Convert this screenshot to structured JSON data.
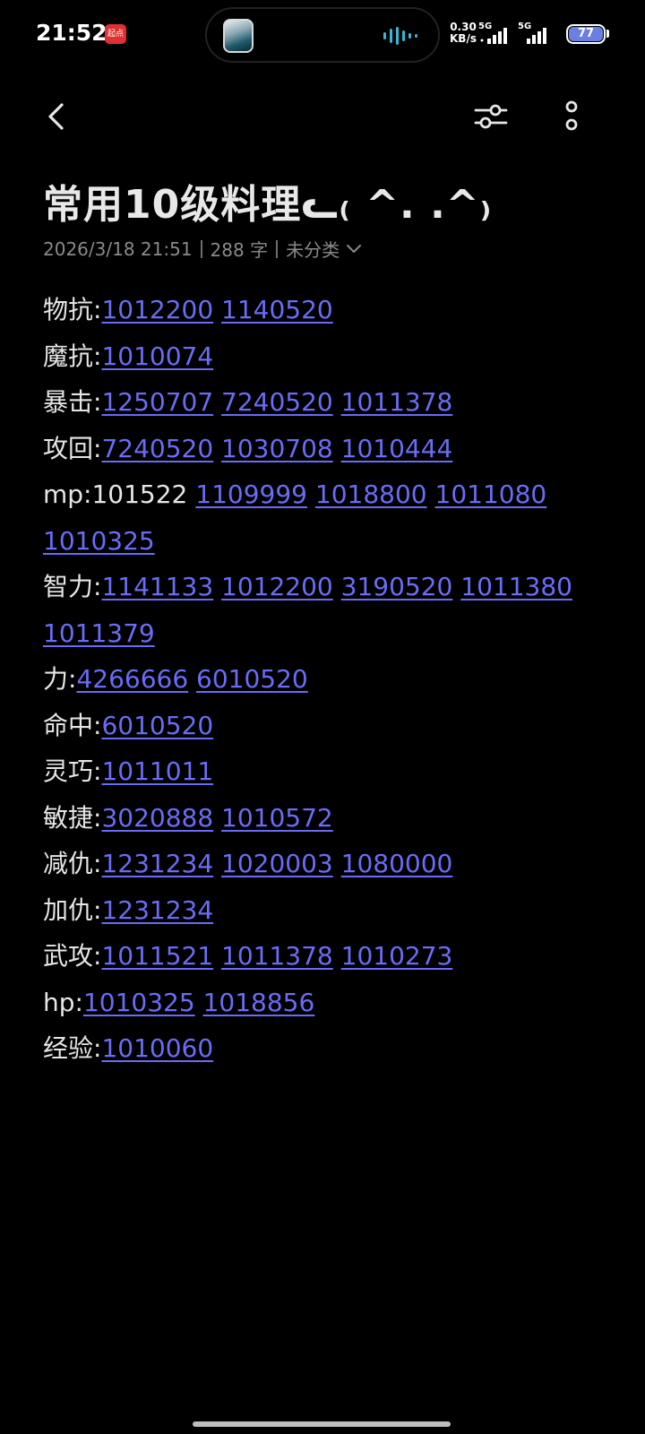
{
  "status_bar": {
    "time": "21:52",
    "app_badge": "起点",
    "net_speed_value": "0.30",
    "net_speed_unit": "KB/s",
    "sim1_label": "5G",
    "sim2_label": "5G",
    "battery": "77"
  },
  "note": {
    "title": "常用10级料理ᓚ₍ ^. .^₎",
    "date": "2026/3/18 21:51",
    "word_count": "288 字",
    "category": "未分类",
    "lines": [
      {
        "label": "物抗:",
        "codes": [
          "1012200",
          "1140520"
        ]
      },
      {
        "label": "魔抗:",
        "codes": [
          "1010074"
        ]
      },
      {
        "label": "暴击:",
        "codes": [
          "1250707",
          "7240520",
          "1011378"
        ]
      },
      {
        "label": "攻回:",
        "codes": [
          "7240520",
          "1030708",
          "1010444"
        ]
      },
      {
        "label": "mp:101522 ",
        "codes": [
          "1109999",
          "1018800",
          "1011080",
          "1010325"
        ]
      },
      {
        "label": "智力:",
        "codes": [
          "1141133",
          "1012200",
          "3190520",
          "1011380",
          "1011379"
        ]
      },
      {
        "label": "力:",
        "codes": [
          "4266666",
          "6010520"
        ]
      },
      {
        "label": "命中:",
        "codes": [
          "6010520"
        ]
      },
      {
        "label": "灵巧:",
        "codes": [
          "1011011"
        ]
      },
      {
        "label": "敏捷:",
        "codes": [
          "3020888",
          "1010572"
        ]
      },
      {
        "label": "减仇:",
        "codes": [
          "1231234",
          "1020003",
          "1080000"
        ]
      },
      {
        "label": "加仇:",
        "codes": [
          "1231234"
        ]
      },
      {
        "label": "武攻:",
        "codes": [
          "1011521",
          "1011378",
          "1010273"
        ]
      },
      {
        "label": "hp:",
        "codes": [
          "1010325",
          "1018856"
        ]
      },
      {
        "label": "经验:",
        "codes": [
          "1010060"
        ]
      }
    ]
  },
  "colors": {
    "background": "#000000",
    "text": "#e6e6e6",
    "link": "#6a6cf5",
    "meta": "#8a8a8a",
    "battery": "#6b7fe0"
  },
  "icons": {
    "back": "back-arrow-icon",
    "filter": "sliders-icon",
    "more": "more-vertical-icon",
    "category_dropdown": "chevron-down-icon"
  }
}
